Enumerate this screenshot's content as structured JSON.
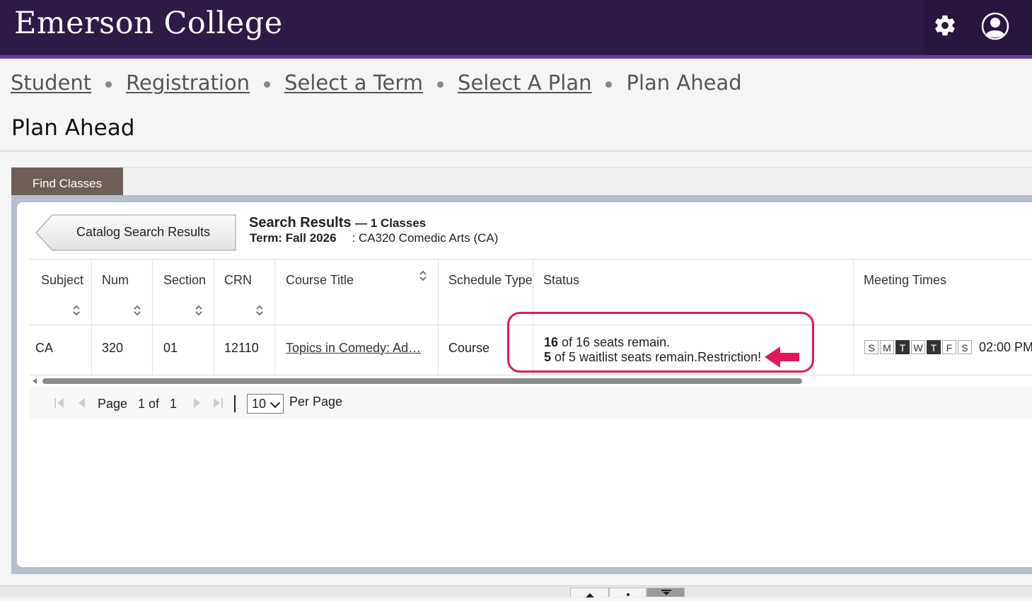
{
  "header": {
    "logo": "Emerson College",
    "icons": [
      "gear-icon",
      "user-icon"
    ],
    "colors": {
      "bar": "#2e1a47",
      "accent": "#6a3a9c"
    }
  },
  "breadcrumb": {
    "links": [
      "Student",
      "Registration",
      "Select a Term",
      "Select A Plan"
    ],
    "current": "Plan Ahead"
  },
  "page_title": "Plan Ahead",
  "tab": {
    "label": "Find Classes",
    "color": "#6d5f57"
  },
  "search": {
    "back_button": "Catalog Search Results",
    "title": "Search Results",
    "count": "— 1 Classes",
    "term_label": "Term: Fall 2026",
    "subject": ": CA320 Comedic Arts (CA)"
  },
  "table": {
    "headers": [
      "Subject",
      "Num",
      "Section",
      "CRN",
      "Course Title",
      "Schedule Type",
      "Status",
      "Meeting Times"
    ],
    "rows": [
      {
        "subject": "CA",
        "num": "320",
        "section": "01",
        "crn": "12110",
        "title": "Topics in Comedy: Ad…",
        "schedule_type": "Course",
        "status": {
          "seats_remaining": "16",
          "seats_text": " of 16 seats remain.",
          "waitlist_remaining": "5",
          "waitlist_text": " of 5 waitlist seats remain.Restriction!"
        },
        "days": [
          {
            "label": "S",
            "active": false
          },
          {
            "label": "M",
            "active": false
          },
          {
            "label": "T",
            "active": true
          },
          {
            "label": "W",
            "active": false
          },
          {
            "label": "T",
            "active": true
          },
          {
            "label": "F",
            "active": false
          },
          {
            "label": "S",
            "active": false
          }
        ],
        "time": "02:00 PM"
      }
    ]
  },
  "pager": {
    "page_label": "Page",
    "current": "1",
    "of_label": "of",
    "total": "1",
    "per_page_value": "10",
    "per_page_label": "Per Page"
  },
  "annotation": {
    "color": "#e0195b"
  }
}
